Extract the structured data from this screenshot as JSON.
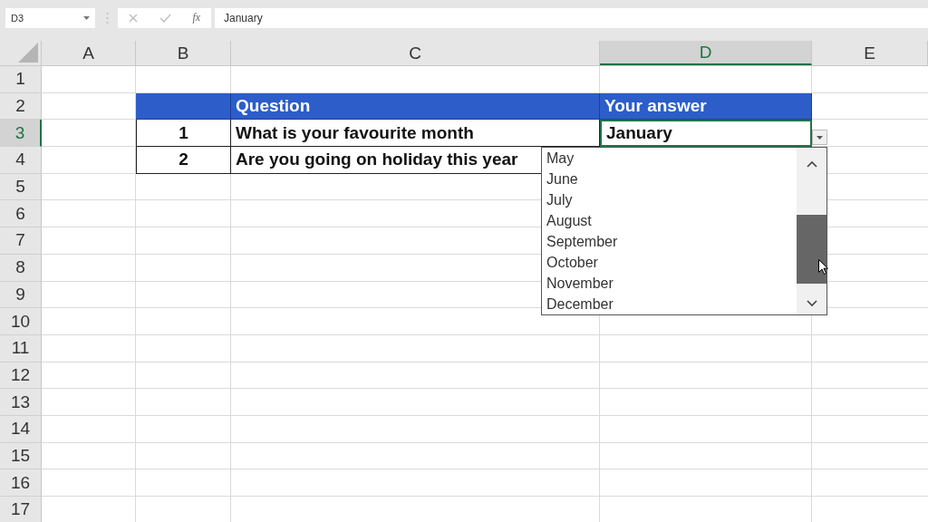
{
  "formula_bar": {
    "name_box": "D3",
    "function_label": "fx",
    "value": "January"
  },
  "columns": [
    {
      "label": "A",
      "selected": false
    },
    {
      "label": "B",
      "selected": false
    },
    {
      "label": "C",
      "selected": false
    },
    {
      "label": "D",
      "selected": true
    },
    {
      "label": "E",
      "selected": false
    }
  ],
  "rows": [
    {
      "label": "1",
      "selected": false
    },
    {
      "label": "2",
      "selected": false
    },
    {
      "label": "3",
      "selected": true
    },
    {
      "label": "4",
      "selected": false
    },
    {
      "label": "5",
      "selected": false
    },
    {
      "label": "6",
      "selected": false
    },
    {
      "label": "7",
      "selected": false
    },
    {
      "label": "8",
      "selected": false
    },
    {
      "label": "9",
      "selected": false
    },
    {
      "label": "10",
      "selected": false
    },
    {
      "label": "11",
      "selected": false
    },
    {
      "label": "12",
      "selected": false
    },
    {
      "label": "13",
      "selected": false
    },
    {
      "label": "14",
      "selected": false
    },
    {
      "label": "15",
      "selected": false
    },
    {
      "label": "16",
      "selected": false
    },
    {
      "label": "17",
      "selected": false
    }
  ],
  "table": {
    "header": {
      "question": "Question",
      "answer": "Your answer"
    },
    "rows": [
      {
        "number": "1",
        "question": "What is your favourite month",
        "answer": "January"
      },
      {
        "number": "2",
        "question": "Are you going on holiday this year"
      }
    ]
  },
  "dropdown": {
    "items": [
      "May",
      "June",
      "July",
      "August",
      "September",
      "October",
      "November",
      "December"
    ]
  }
}
